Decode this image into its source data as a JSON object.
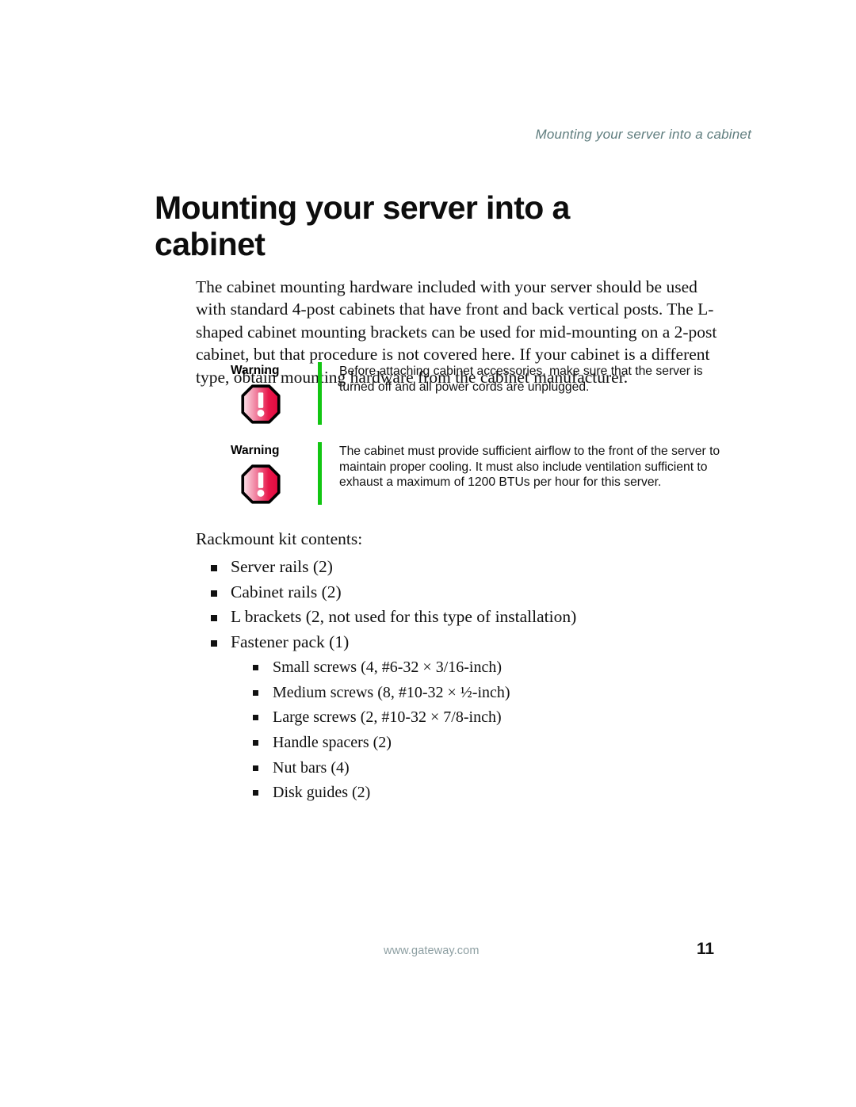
{
  "header": {
    "running_title": "Mounting your server into a cabinet"
  },
  "title": "Mounting your server into a cabinet",
  "intro_paragraph": "The cabinet mounting hardware included with your server should be used with standard 4-post cabinets that have front and back vertical posts. The L-shaped cabinet mounting brackets can be used for mid-mounting on a 2-post cabinet, but that procedure is not covered here. If your cabinet is a different type, obtain mounting hardware from the cabinet manufacturer.",
  "warnings": [
    {
      "label": "Warning",
      "icon": "warning-octagon-icon",
      "text": "Before attaching cabinet accessories, make sure that the server is turned off and all power cords are unplugged."
    },
    {
      "label": "Warning",
      "icon": "warning-octagon-icon",
      "text": "The cabinet must provide sufficient airflow to the front of the server to maintain proper cooling.  It must also include ventilation sufficient to exhaust a maximum of 1200 BTUs per hour for this server."
    }
  ],
  "list_intro": "Rackmount kit contents:",
  "kit_items": [
    "Server rails (2)",
    "Cabinet rails (2)",
    "L brackets (2, not used for this type of installation)",
    "Fastener pack (1)"
  ],
  "kit_subitems": [
    "Small screws (4, #6-32 × 3/16-inch)",
    "Medium screws (8, #10-32 × ½-inch)",
    "Large screws (2, #10-32 × 7/8-inch)",
    "Handle spacers (2)",
    "Nut bars (4)",
    "Disk guides (2)"
  ],
  "footer": {
    "url": "www.gateway.com",
    "page_number": "11"
  },
  "colors": {
    "header_text": "#5f7d7e",
    "warning_rule": "#12c612",
    "warning_icon_red": "#e8174a",
    "footer_url": "#8d9fa2",
    "body_text": "#111111"
  }
}
